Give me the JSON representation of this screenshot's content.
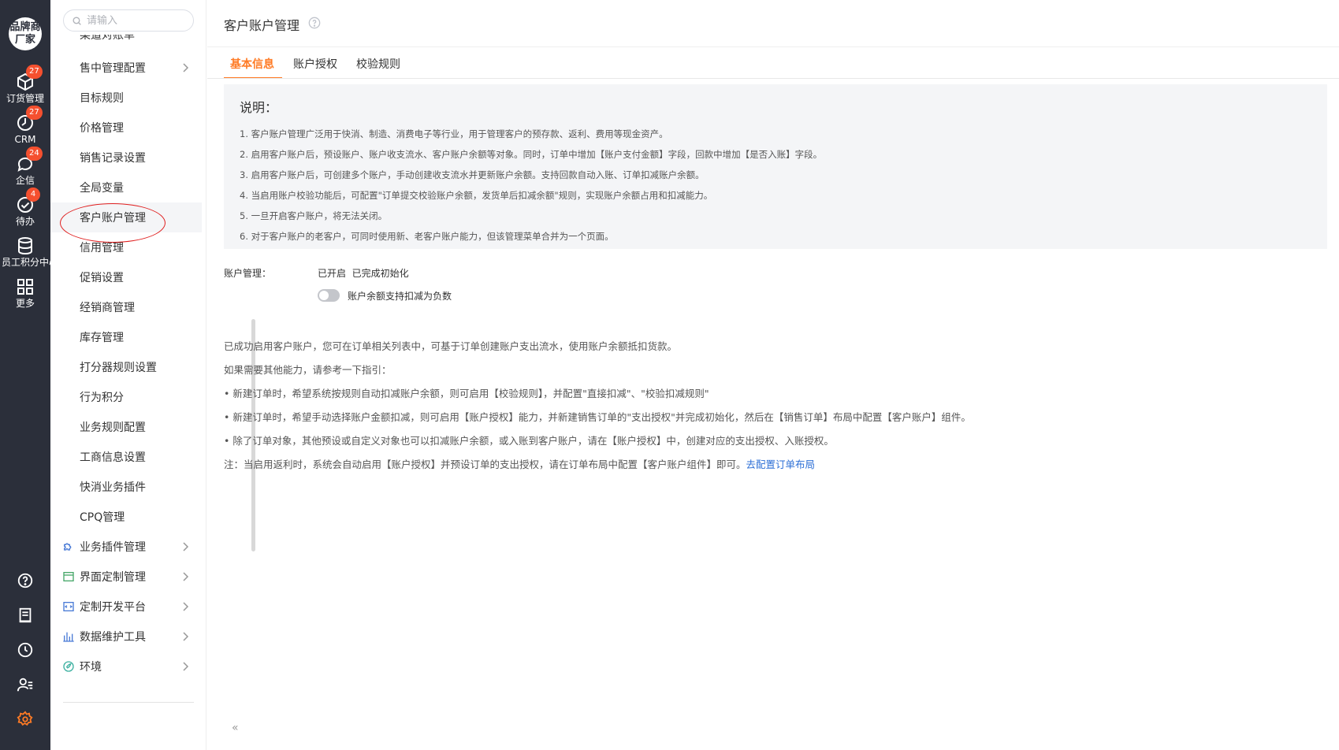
{
  "rail": {
    "brand": [
      "品牌商",
      "厂家"
    ],
    "items": [
      {
        "label": "订货管理",
        "badge": "27",
        "icon": "package-icon"
      },
      {
        "label": "CRM",
        "badge": "27",
        "icon": "crm-clock-icon"
      },
      {
        "label": "企信",
        "badge": "24",
        "icon": "chat-bubble-icon"
      },
      {
        "label": "待办",
        "badge": "4",
        "icon": "check-circle-icon"
      },
      {
        "label": "员工积分中心",
        "badge": "",
        "icon": "database-icon"
      },
      {
        "label": "更多",
        "badge": "",
        "icon": "grid-icon"
      }
    ],
    "bottom_icons": [
      "help-circle-icon",
      "notepad-icon",
      "clock-icon",
      "user-list-icon",
      "settings-gear-icon"
    ],
    "accent": "#ff7b25"
  },
  "nav": {
    "search_placeholder": "请输入",
    "partial_item": "渠道对账单",
    "items": [
      {
        "label": "售中管理配置",
        "chevron": true
      },
      {
        "label": "目标规则",
        "chevron": false
      },
      {
        "label": "价格管理",
        "chevron": false
      },
      {
        "label": "销售记录设置",
        "chevron": false
      },
      {
        "label": "全局变量",
        "chevron": false
      },
      {
        "label": "客户账户管理",
        "chevron": false,
        "active": true
      },
      {
        "label": "信用管理",
        "chevron": false
      },
      {
        "label": "促销设置",
        "chevron": false
      },
      {
        "label": "经销商管理",
        "chevron": false
      },
      {
        "label": "库存管理",
        "chevron": false
      },
      {
        "label": "打分器规则设置",
        "chevron": false
      },
      {
        "label": "行为积分",
        "chevron": false
      },
      {
        "label": "业务规则配置",
        "chevron": false
      },
      {
        "label": "工商信息设置",
        "chevron": false
      },
      {
        "label": "快消业务插件",
        "chevron": false
      },
      {
        "label": "CPQ管理",
        "chevron": false
      }
    ],
    "groups": [
      {
        "label": "业务插件管理",
        "icon": "puzzle-icon"
      },
      {
        "label": "界面定制管理",
        "icon": "window-icon"
      },
      {
        "label": "定制开发平台",
        "icon": "code-icon"
      },
      {
        "label": "数据维护工具",
        "icon": "bar-chart-icon"
      },
      {
        "label": "环境",
        "icon": "leaf-icon"
      }
    ],
    "collapse_label": "«"
  },
  "main": {
    "title": "客户账户管理",
    "tabs": [
      "基本信息",
      "账户授权",
      "校验规则"
    ],
    "info": {
      "title": "说明：",
      "lines": [
        "1. 客户账户管理广泛用于快消、制造、消费电子等行业，用于管理客户的预存款、返利、费用等现金资产。",
        "2. 启用客户账户后，预设账户、账户收支流水、客户账户余额等对象。同时，订单中增加【账户支付金额】字段，回款中增加【是否入账】字段。",
        "3. 启用客户账户后，可创建多个账户，手动创建收支流水并更新账户余额。支持回款自动入账、订单扣减账户余额。",
        "4. 当启用账户校验功能后，可配置\"订单提交校验账户余额，发货单后扣减余额\"规则，实现账户余额占用和扣减能力。",
        "5. 一旦开启客户账户，将无法关闭。",
        "6. 对于客户账户的老客户，可同时使用新、老客户账户能力，但该管理菜单合并为一个页面。"
      ]
    },
    "account_label": "账户管理：",
    "account_status": "已开启  已完成初始化",
    "toggle_label": "账户余额支持扣减为负数",
    "toggle_on": false,
    "guide": [
      "已成功启用客户账户，您可在订单相关列表中，可基于订单创建账户支出流水，使用账户余额抵扣货款。",
      "如果需要其他能力，请参考一下指引：",
      "• 新建订单时，希望系统按规则自动扣减账户余额，则可启用【校验规则】，并配置\"直接扣减\"、\"校验扣减规则\"",
      "• 新建订单时，希望手动选择账户金额扣减，则可启用【账户授权】能力，并新建销售订单的\"支出授权\"并完成初始化，然后在【销售订单】布局中配置【客户账户】组件。",
      "• 除了订单对象，其他预设或自定义对象也可以扣减账户余额，或入账到客户账户，请在【账户授权】中，创建对应的支出授权、入账授权。"
    ],
    "note": "注：当启用返利时，系统会自动启用【账户授权】并预设订单的支出授权，请在订单布局中配置【客户账户组件】即可。",
    "note_link": "去配置订单布局"
  }
}
